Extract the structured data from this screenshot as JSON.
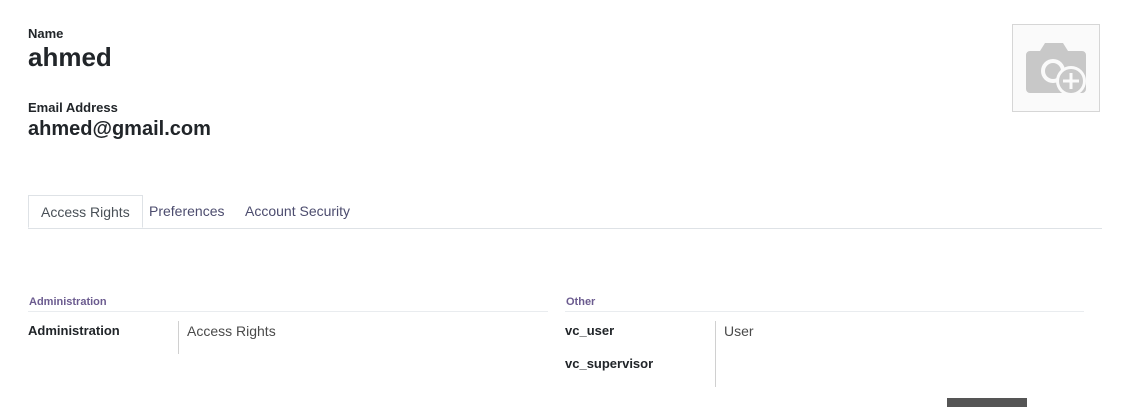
{
  "user": {
    "name_label": "Name",
    "name": "ahmed",
    "email_label": "Email Address",
    "email": "ahmed@gmail.com"
  },
  "avatar": {
    "icon": "camera-plus-icon"
  },
  "tabs": [
    {
      "label": "Access Rights",
      "active": true
    },
    {
      "label": "Preferences",
      "active": false
    },
    {
      "label": "Account Security",
      "active": false
    }
  ],
  "groups": {
    "administration": {
      "title": "Administration",
      "rows": [
        {
          "label": "Administration",
          "value": "Access Rights"
        }
      ]
    },
    "other": {
      "title": "Other",
      "rows": [
        {
          "label": "vc_user",
          "value": "User"
        },
        {
          "label": "vc_supervisor",
          "value": ""
        }
      ]
    }
  }
}
